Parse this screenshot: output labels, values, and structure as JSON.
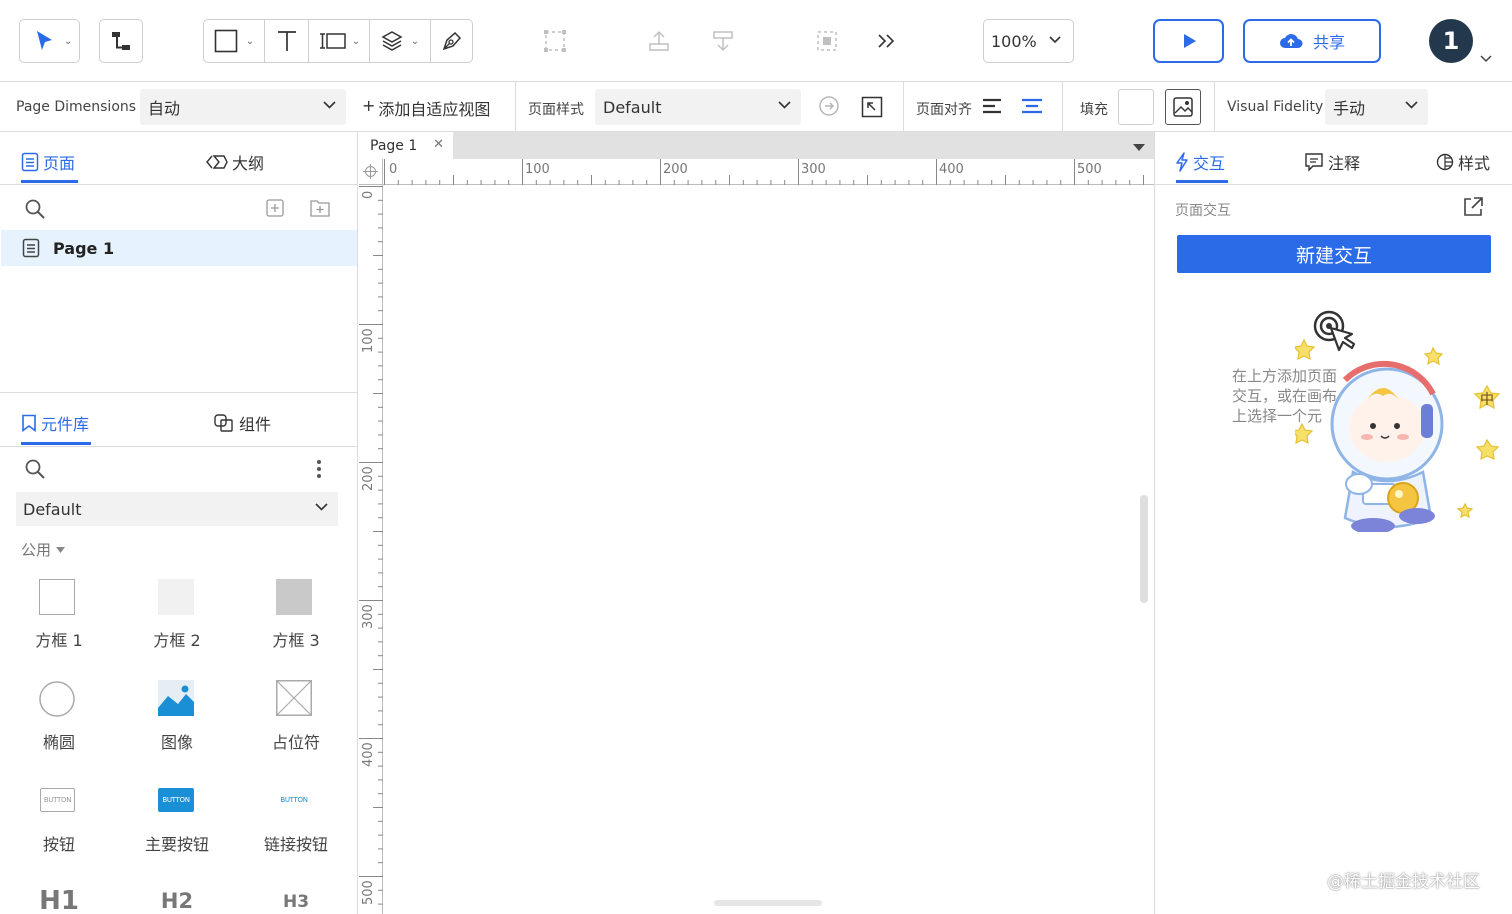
{
  "toolbar": {
    "zoom": "100%",
    "share_label": "共享",
    "avatar_text": "1"
  },
  "properties_bar": {
    "page_dimensions_label": "Page Dimensions",
    "page_dimensions_value": "自动",
    "add_adaptive_view": "添加自适应视图",
    "page_style_label": "页面样式",
    "page_style_value": "Default",
    "page_align_label": "页面对齐",
    "fill_label": "填充",
    "visual_fidelity_label": "Visual Fidelity",
    "visual_fidelity_value": "手动"
  },
  "left_panel": {
    "tabs": [
      {
        "label": "页面"
      },
      {
        "label": "大纲"
      }
    ],
    "pages": [
      {
        "label": "Page 1"
      }
    ],
    "library_tabs": [
      {
        "label": "元件库"
      },
      {
        "label": "组件"
      }
    ],
    "library_select": "Default",
    "category": "公用",
    "widgets": [
      {
        "label": "方框 1"
      },
      {
        "label": "方框 2"
      },
      {
        "label": "方框 3"
      },
      {
        "label": "椭圆"
      },
      {
        "label": "图像"
      },
      {
        "label": "占位符"
      },
      {
        "label": "按钮"
      },
      {
        "label": "主要按钮"
      },
      {
        "label": "链接按钮"
      },
      {
        "label": "H1"
      },
      {
        "label": "H2"
      },
      {
        "label": "H3"
      }
    ],
    "button_thumb_text": "BUTTON"
  },
  "canvas": {
    "page_tab": "Page 1",
    "ruler_h": [
      "0",
      "100",
      "200",
      "300",
      "400",
      "500"
    ],
    "ruler_v": [
      "0",
      "100",
      "200",
      "300",
      "400",
      "500"
    ]
  },
  "right_panel": {
    "tabs": [
      {
        "label": "交互"
      },
      {
        "label": "注释"
      },
      {
        "label": "样式"
      }
    ],
    "section_title": "页面交互",
    "new_interaction": "新建交互",
    "hint_text": "在上方添加页面交互，或在画布上选择一个元件，为其添加交互，有交互的元件"
  },
  "watermark": "@稀土掘金技术社区",
  "colors": {
    "accent": "#2b6be8",
    "avatar": "#24384d",
    "selected_row": "#e6f2fd"
  }
}
